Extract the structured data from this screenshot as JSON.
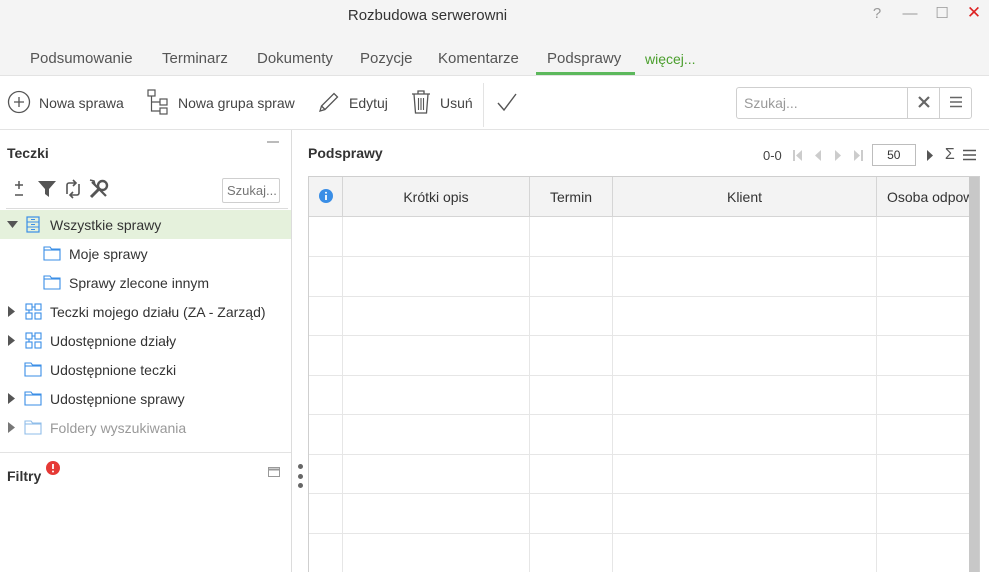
{
  "window": {
    "title": "Rozbudowa serwerowni",
    "help": "?",
    "minimize": "—",
    "maximize": "☐",
    "close": "✕"
  },
  "tabs": [
    {
      "label": "Podsumowanie"
    },
    {
      "label": "Terminarz"
    },
    {
      "label": "Dokumenty"
    },
    {
      "label": "Pozycje"
    },
    {
      "label": "Komentarze"
    },
    {
      "label": "Podsprawy",
      "active": true
    },
    {
      "label": "więcej..."
    }
  ],
  "toolbar": {
    "new_case": "Nowa sprawa",
    "new_group": "Nowa grupa spraw",
    "edit": "Edytuj",
    "delete": "Usuń",
    "search_placeholder": "Szukaj..."
  },
  "left_panel": {
    "title": "Teczki",
    "search_placeholder": "Szukaj...",
    "tree": [
      {
        "label": "Wszystkie sprawy",
        "selected": true
      },
      {
        "label": "Moje sprawy"
      },
      {
        "label": "Sprawy zlecone innym"
      },
      {
        "label": "Teczki mojego działu (ZA - Zarząd)"
      },
      {
        "label": "Udostępnione działy"
      },
      {
        "label": "Udostępnione teczki"
      },
      {
        "label": "Udostępnione sprawy"
      },
      {
        "label": "Foldery wyszukiwania",
        "disabled": true
      }
    ],
    "filters_title": "Filtry"
  },
  "right_panel": {
    "title": "Podsprawy",
    "range": "0-0",
    "page_size": "50",
    "columns": [
      "Krótki opis",
      "Termin",
      "Klient",
      "Osoba odpowiedzialna"
    ]
  },
  "colors": {
    "accent_green": "#5cb85c",
    "selected_bg": "#e5f1dc",
    "error_red": "#e53935",
    "info_blue": "#3a8ee6"
  }
}
